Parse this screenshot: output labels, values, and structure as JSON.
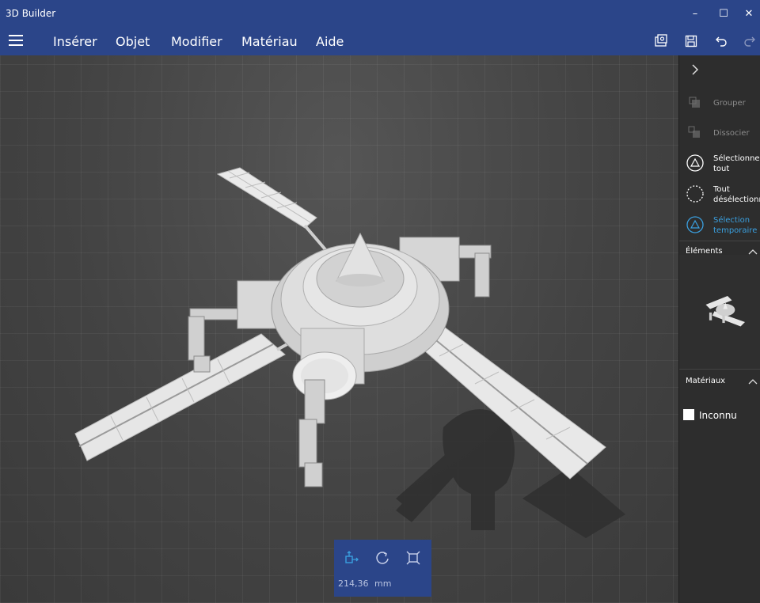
{
  "app": {
    "title": "3D Builder"
  },
  "window_controls": {
    "minimize": "–",
    "maximize": "☐",
    "close": "✕"
  },
  "menu": {
    "items": [
      "Insérer",
      "Objet",
      "Modifier",
      "Matériau",
      "Aide"
    ],
    "toolbar_icons": [
      "share-icon",
      "save-icon",
      "undo-icon",
      "redo-icon"
    ]
  },
  "panel": {
    "actions": [
      {
        "label_line1": "Grouper",
        "label_line2": "",
        "icon": "group-icon",
        "state": "disabled"
      },
      {
        "label_line1": "Dissocier",
        "label_line2": "",
        "icon": "ungroup-icon",
        "state": "disabled"
      },
      {
        "label_line1": "Sélectionner",
        "label_line2": "tout",
        "icon": "select-all-icon",
        "state": "normal"
      },
      {
        "label_line1": "Tout",
        "label_line2": "désélectionne",
        "icon": "deselect-all-icon",
        "state": "normal"
      },
      {
        "label_line1": "Sélection",
        "label_line2": "temporaire",
        "icon": "temp-selection-icon",
        "state": "accent"
      }
    ],
    "elements_title": "Éléments",
    "materials_title": "Matériaux",
    "material_name": "Inconnu"
  },
  "bottom_toolbar": {
    "value": "214,36",
    "unit": "mm",
    "icons": [
      "move-icon",
      "rotate-icon",
      "scale-icon"
    ]
  },
  "colors": {
    "accent": "#2b4589",
    "highlight": "#3aa0e0"
  }
}
